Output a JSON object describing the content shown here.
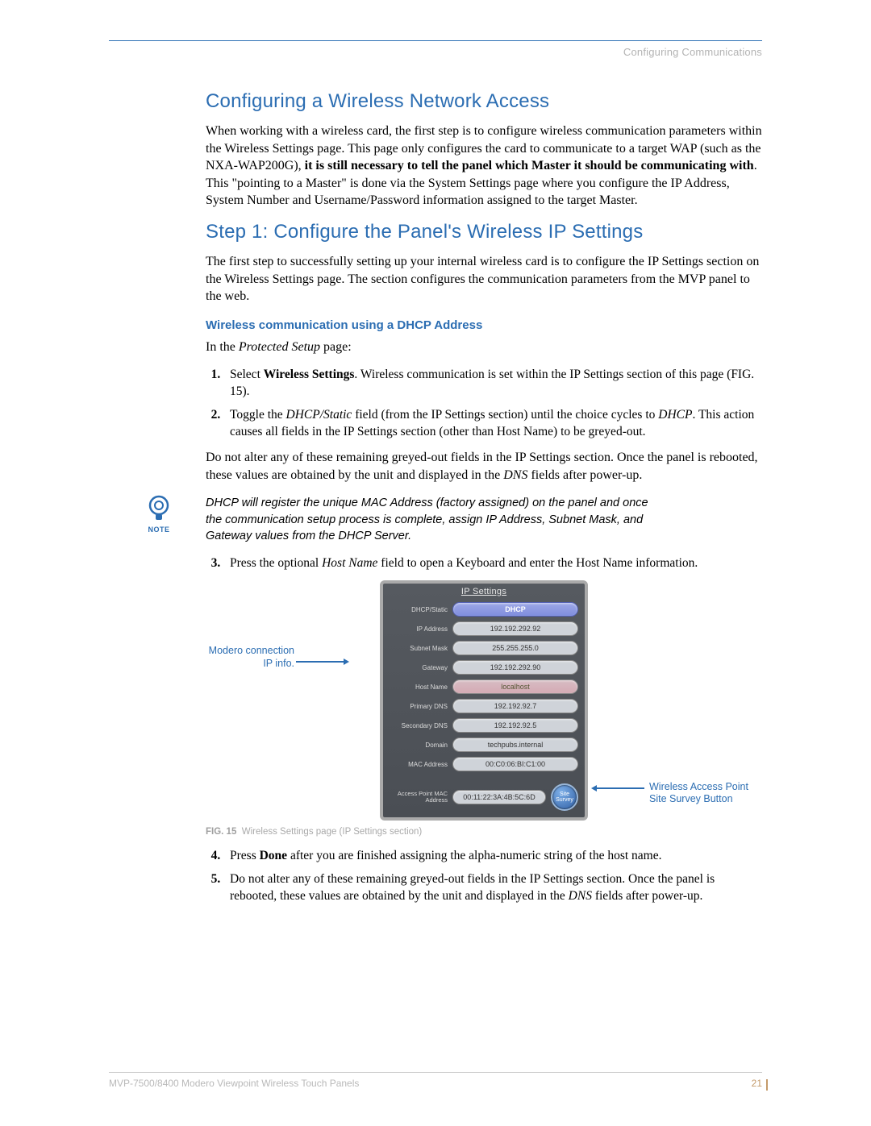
{
  "header": {
    "breadcrumb": "Configuring Communications"
  },
  "section1": {
    "title": "Configuring a Wireless Network Access",
    "para_a": "When working with a wireless card, the first step is to configure wireless communication parameters within the Wireless Settings page. This page only configures the card to communicate to a target WAP (such as the NXA-WAP200G), ",
    "para_bold": "it is still necessary to tell the panel which Master it should be communicating with",
    "para_b": ". This \"pointing to a Master\" is done via the System Settings page where you configure the IP Address, System Number and Username/Password information assigned to the target Master."
  },
  "section2": {
    "title": "Step 1: Configure the Panel's Wireless IP Settings",
    "para": "The first step to successfully setting up your internal wireless card is to configure the IP Settings section on the Wireless Settings page. The section configures the communication parameters from the MVP panel to the web."
  },
  "sub": {
    "title": "Wireless communication using a DHCP Address",
    "intro_a": "In the ",
    "intro_em": "Protected Setup",
    "intro_b": " page:"
  },
  "steps1": {
    "s1a": "Select ",
    "s1b": "Wireless Settings",
    "s1c": ". Wireless communication is set within the IP Settings section of this page (FIG. 15).",
    "s2a": "Toggle the ",
    "s2em": "DHCP/Static",
    "s2b": " field (from the IP Settings section) until the choice cycles to ",
    "s2em2": "DHCP",
    "s2c": ". This action causes all fields in the IP Settings section (other than Host Name) to be greyed-out."
  },
  "after1": {
    "a": "Do not alter any of these remaining greyed-out fields in the IP Settings section. Once the panel is rebooted, these values are obtained by the unit and displayed in the ",
    "em": "DNS",
    "b": " fields after power-up."
  },
  "note": {
    "label": "NOTE",
    "text": "DHCP will register the unique MAC Address (factory assigned) on the panel and once the communication setup process is complete, assign IP Address, Subnet Mask, and Gateway values from the DHCP Server."
  },
  "step3": {
    "a": "Press the optional ",
    "em": "Host Name",
    "b": " field to open a Keyboard and enter the Host Name information."
  },
  "figure": {
    "title": "IP Settings",
    "callout_left": "Modero connection IP info.",
    "callout_right_1": "Wireless Access Point",
    "callout_right_2": "Site Survey Button",
    "site_btn_1": "Site",
    "site_btn_2": "Survey",
    "caption_label": "FIG. 15",
    "caption_text": "Wireless Settings page (IP Settings section)",
    "rows": [
      {
        "label": "DHCP/Static",
        "value": "DHCP",
        "variant": "primary"
      },
      {
        "label": "IP Address",
        "value": "192.192.292.92",
        "variant": ""
      },
      {
        "label": "Subnet Mask",
        "value": "255.255.255.0",
        "variant": ""
      },
      {
        "label": "Gateway",
        "value": "192.192.292.90",
        "variant": ""
      },
      {
        "label": "Host Name",
        "value": "localhost",
        "variant": "hostname"
      },
      {
        "label": "Primary DNS",
        "value": "192.192.92.7",
        "variant": ""
      },
      {
        "label": "Secondary DNS",
        "value": "192.192.92.5",
        "variant": ""
      },
      {
        "label": "Domain",
        "value": "techpubs.internal",
        "variant": ""
      },
      {
        "label": "MAC Address",
        "value": "00:C0:06:BI:C1:00",
        "variant": ""
      }
    ],
    "ap": {
      "label": "Access Point MAC Address",
      "value": "00:11:22:3A:4B:5C:6D"
    }
  },
  "steps2": {
    "s4a": "Press ",
    "s4b": "Done",
    "s4c": " after you are finished assigning the alpha-numeric string of the host name.",
    "s5a": "Do not alter any of these remaining greyed-out fields in the IP Settings section. Once the panel is rebooted, these values are obtained by the unit and displayed in the ",
    "s5em": "DNS",
    "s5b": " fields after power-up."
  },
  "footer": {
    "product": "MVP-7500/8400 Modero Viewpoint Wireless Touch Panels",
    "page": "21"
  }
}
